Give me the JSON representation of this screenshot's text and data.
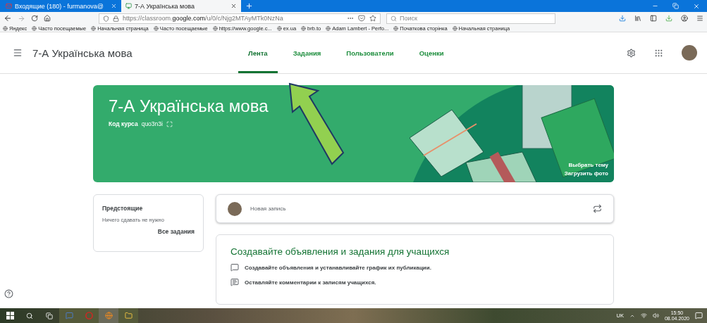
{
  "browser": {
    "tabs": [
      {
        "title": "Входящие (180) - furmanova@",
        "selected": false
      },
      {
        "title": "7-А Українська мова",
        "selected": true
      }
    ],
    "url": {
      "prefix": "https://classroom.",
      "domain": "google.com",
      "path": "/u/0/c/Njg2MTAyMTk0NzNa"
    },
    "search": {
      "placeholder": "Поиск"
    },
    "bookmarks": [
      "Яндекс",
      "Часто посещаемые",
      "Начальная страница",
      "Часто посещаемые",
      "https://www.google.c...",
      "ex.ua",
      "brb.to",
      "Adam Lambert - Perfo...",
      "Початкова сторінка",
      "Начальная страница"
    ]
  },
  "classroom": {
    "title": "7-А Українська мова",
    "nav": [
      {
        "label": "Лента",
        "selected": true
      },
      {
        "label": "Задания",
        "selected": false
      },
      {
        "label": "Пользователи",
        "selected": false
      },
      {
        "label": "Оценки",
        "selected": false
      }
    ],
    "banner": {
      "title": "7-А Українська мова",
      "code_label": "Код курса",
      "code": "quo3n3i",
      "theme_link": "Выбрать тему",
      "upload_link": "Загрузить фото"
    },
    "upcoming": {
      "title": "Предстоящие",
      "text": "Ничего сдавать не нужно",
      "link": "Все задания"
    },
    "post": {
      "placeholder": "Новая запись"
    },
    "info": {
      "heading": "Создавайте объявления и задания для учащихся",
      "items": [
        {
          "kind": "announce",
          "text": "Создавайте объявления и устанавливайте график их публикации."
        },
        {
          "kind": "comment",
          "text": "Оставляйте комментарии к записям учащихся."
        }
      ]
    }
  },
  "taskbar": {
    "language": "UK",
    "time": "15:50",
    "date": "08.04.2020"
  }
}
